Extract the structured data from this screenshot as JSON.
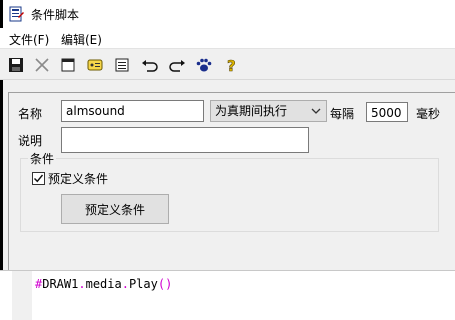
{
  "window": {
    "title": "条件脚本"
  },
  "menu": {
    "file": "文件(F)",
    "edit": "编辑(E)"
  },
  "toolbar": {
    "buttons": [
      "save-icon",
      "delete-icon",
      "new-icon",
      "tag-icon",
      "list-icon",
      "undo-icon",
      "redo-icon",
      "paw-icon",
      "help-icon"
    ]
  },
  "form": {
    "name_label": "名称",
    "name_value": "almsound",
    "mode_value": "为真期间执行",
    "interval_label": "每隔",
    "interval_value": "5000",
    "interval_unit": "毫秒",
    "desc_label": "说明",
    "desc_value": ""
  },
  "condition": {
    "group_label": "条件",
    "checkbox_label": "预定义条件",
    "checked": true,
    "button_label": "预定义条件"
  },
  "editor": {
    "hash": "#",
    "obj": "DRAW1",
    "dot1": ".",
    "prop": "media",
    "dot2": ".",
    "method": "Play",
    "parens": "()"
  },
  "colors": {
    "panel": "#f0f0f0",
    "syntax_accent": "#d000d0"
  }
}
